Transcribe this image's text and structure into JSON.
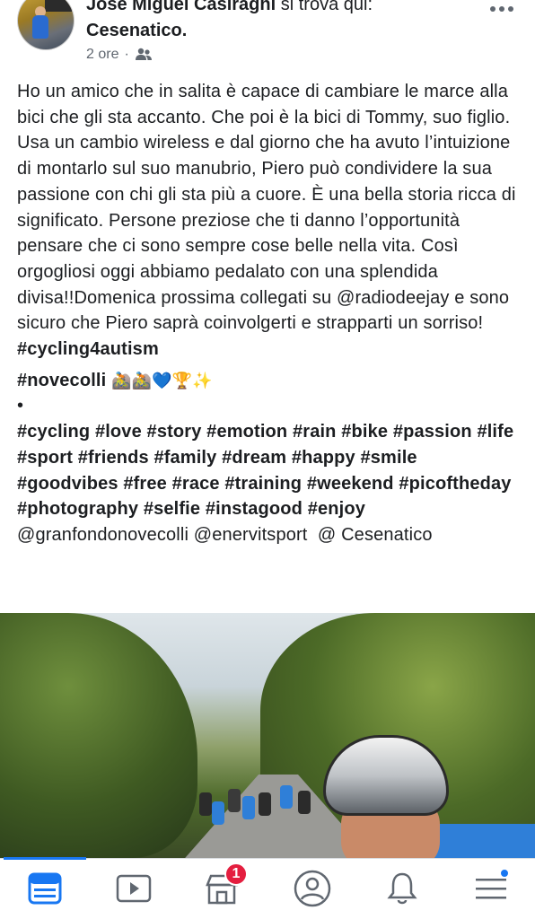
{
  "post": {
    "author": "José Miguel Casiraghi",
    "location_phrase": "si trova qui:",
    "location": "Cesenatico.",
    "time": "2 ore",
    "audience_icon": "friends-icon",
    "more_icon": "more-options-icon",
    "text_main": "Ho un amico che in salita è capace di cambiare le marce alla bici che gli sta accanto. Che poi è la bici di Tommy, suo figlio. Usa un cambio wireless e dal giorno che ha avuto l’intuizione di montarlo sul suo manubrio, Piero può condividere la sua passione con chi gli sta più a cuore. È una bella storia ricca di significato. Persone preziose che ti danno l’opportunità pensare che ci sono sempre cose belle nella vita. Così orgogliosi oggi abbiamo pedalato con una splendida divisa!!Domenica prossima collegati su @radiodeejay e sono sicuro che Piero saprà coinvolgerti e strapparti un sorriso! ",
    "tag_cycling4autism": "#cycling4autism",
    "tag_novecolli": "#novecolli",
    "emojis": "🚵🚵💙🏆✨",
    "bullet": "•",
    "hashtags": "#cycling #love #story #emotion #rain #bike #passion #life #sport #friends #family #dream #happy #smile #goodvibes #free #race #training #weekend #picoftheday #photography #selfie #instagood #enjoy",
    "mentions": " @granfondonovecolli @enervitsport  @ Cesenatico",
    "photo_alt": "cycling-group-photo"
  },
  "tabbar": {
    "tabs": [
      {
        "name": "news-feed",
        "icon": "news-feed-icon",
        "active": true
      },
      {
        "name": "watch",
        "icon": "video-icon"
      },
      {
        "name": "marketplace",
        "icon": "marketplace-icon",
        "badge": "1"
      },
      {
        "name": "profile",
        "icon": "profile-icon"
      },
      {
        "name": "notifications",
        "icon": "bell-icon"
      },
      {
        "name": "menu",
        "icon": "menu-icon",
        "dot": true
      }
    ],
    "marketplace_badge": "1"
  },
  "colors": {
    "accent": "#1877f2",
    "badge": "#e41e3f",
    "text": "#1c1e21",
    "meta": "#606770"
  }
}
